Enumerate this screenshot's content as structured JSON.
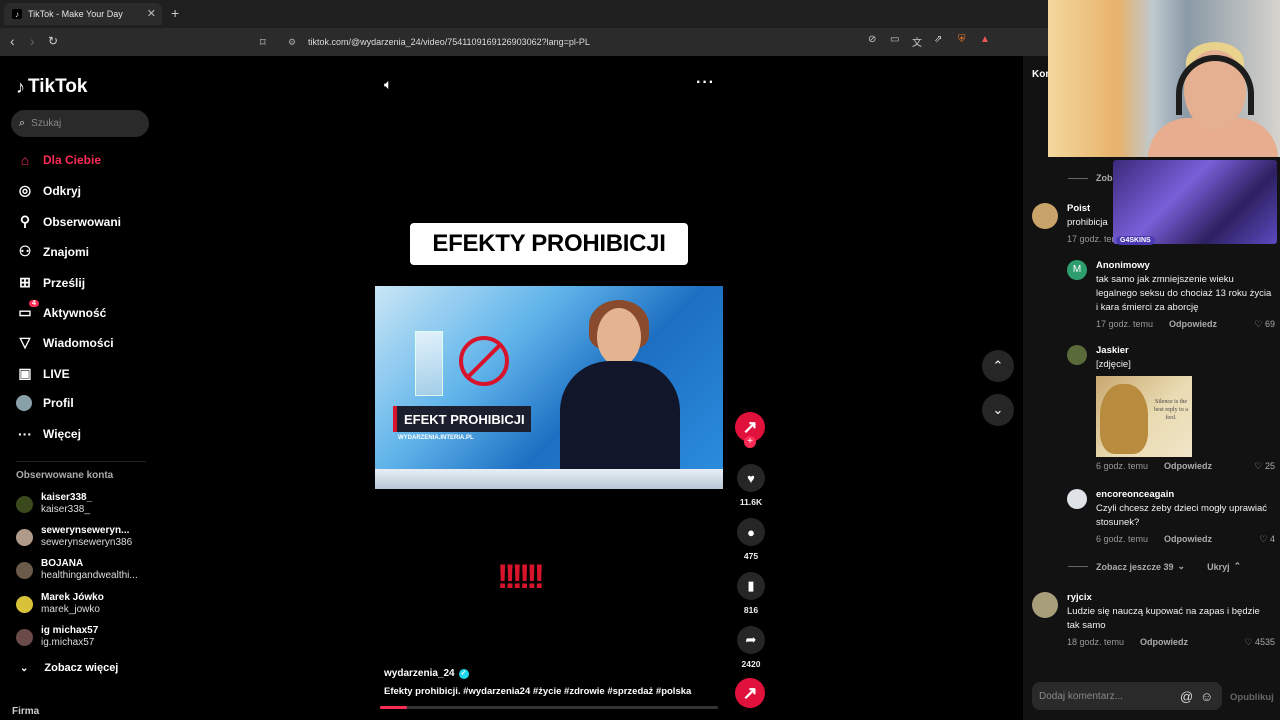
{
  "browser": {
    "tab_title": "TikTok - Make Your Day",
    "url": "tiktok.com/@wydarzenia_24/video/7541109169126903062?lang=pl-PL"
  },
  "sidebar": {
    "logo": "TikTok",
    "search_placeholder": "Szukaj",
    "nav": [
      {
        "label": "Dla Ciebie",
        "icon": "home-icon"
      },
      {
        "label": "Odkryj",
        "icon": "compass-icon"
      },
      {
        "label": "Obserwowani",
        "icon": "following-icon"
      },
      {
        "label": "Znajomi",
        "icon": "friends-icon"
      },
      {
        "label": "Prześlij",
        "icon": "upload-icon"
      },
      {
        "label": "Aktywność",
        "icon": "activity-icon",
        "badge": "4"
      },
      {
        "label": "Wiadomości",
        "icon": "messages-icon"
      },
      {
        "label": "LIVE",
        "icon": "live-icon"
      },
      {
        "label": "Profil",
        "icon": "profile-icon"
      },
      {
        "label": "Więcej",
        "icon": "more-icon"
      }
    ],
    "followed_title": "Obserwowane konta",
    "accounts": [
      {
        "name": "kaiser338_",
        "handle": "kaiser338_"
      },
      {
        "name": "sewerynseweryn...",
        "handle": "sewerynseweryn386"
      },
      {
        "name": "BOJANA",
        "handle": "healthingandwealthi..."
      },
      {
        "name": "Marek Jówko",
        "handle": "marek_jowko"
      },
      {
        "name": "ig michax57",
        "handle": "ig.michax57"
      }
    ],
    "see_more": "Zobacz więcej",
    "footer": "Firma"
  },
  "video": {
    "overlay_title": "EFEKTY PROHIBICJI",
    "news_banner": "EFEKT PROHIBICJI",
    "news_source": "WYDARZENIA.INTERIA.PL",
    "exclamations": "!!!!!!",
    "author": "wydarzenia_24",
    "caption": "Efekty prohibicji. #wydarzenia24 #życie #zdrowie #sprzedaż #polska",
    "progress": 0.08,
    "likes": "11.6K",
    "comments": "475",
    "saves": "816",
    "shares": "2420"
  },
  "comments": {
    "title": "Komentarze",
    "overlay_tag": "G4SKINS",
    "items": [
      {
        "user": "Poist",
        "text": "prohibicja",
        "time": "17 godz. temu"
      },
      {
        "user": "Anonimowy",
        "text": "tak samo jak zmniejszenie wieku legalnego seksu do chociaż 13 roku życia i kara śmierci za aborcję",
        "time": "17 godz. temu",
        "reply": "Odpowiedz",
        "likes": "69"
      },
      {
        "user": "Jaskier",
        "text": "[zdjęcie]",
        "time": "6 godz. temu",
        "reply": "Odpowiedz",
        "likes": "25",
        "image_text": "Silence is the best reply to a fool."
      },
      {
        "user": "encoreoncеagain",
        "text": "Czyli chcesz żeby dzieci mogły uprawiać stosunek?",
        "time": "6 godz. temu",
        "reply": "Odpowiedz",
        "likes": "4"
      },
      {
        "user": "ryjcix",
        "text": "Ludzie się nauczą kupować na zapas i będzie tak samo",
        "time": "18 godz. temu",
        "reply": "Odpowiedz",
        "likes": "4535"
      }
    ],
    "see_more_top": "Zobacz",
    "see_more_39": "Zobacz jeszcze 39",
    "hide": "Ukryj",
    "input_placeholder": "Dodaj komentarz...",
    "publish": "Opublikuj"
  }
}
